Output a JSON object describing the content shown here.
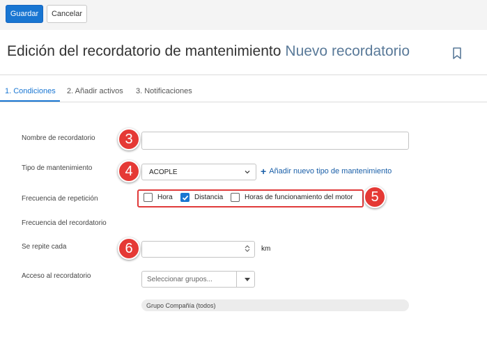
{
  "toolbar": {
    "save_label": "Guardar",
    "cancel_label": "Cancelar"
  },
  "header": {
    "title": "Edición del recordatorio de mantenimiento",
    "subtitle": "Nuevo recordatorio",
    "bookmark_icon": "bookmark-icon"
  },
  "tabs": [
    {
      "label": "1. Condiciones",
      "active": true
    },
    {
      "label": "2. Añadir activos",
      "active": false
    },
    {
      "label": "3. Notificaciones",
      "active": false
    }
  ],
  "form": {
    "name_label": "Nombre de recordatorio",
    "name_value": "",
    "type_label": "Tipo de mantenimiento",
    "type_value": "ACOPLE",
    "add_type_link": "Añadir nuevo tipo de mantenimiento",
    "repeat_freq_label": "Frecuencia de repetición",
    "freq_options": [
      {
        "label": "Hora",
        "checked": false
      },
      {
        "label": "Distancia",
        "checked": true
      },
      {
        "label": "Horas de funcionamiento del motor",
        "checked": false
      }
    ],
    "reminder_freq_label": "Frecuencia del recordatorio",
    "repeats_every_label": "Se repite cada",
    "repeats_every_value": "",
    "repeats_unit": "km",
    "access_label": "Acceso al recordatorio",
    "groups_placeholder": "Seleccionar grupos...",
    "selected_group": "Grupo Compañía (todos)"
  },
  "callouts": [
    "3",
    "4",
    "5",
    "6"
  ],
  "colors": {
    "accent": "#1976d2",
    "callout": "#e53935",
    "link": "#1a5fa8"
  }
}
